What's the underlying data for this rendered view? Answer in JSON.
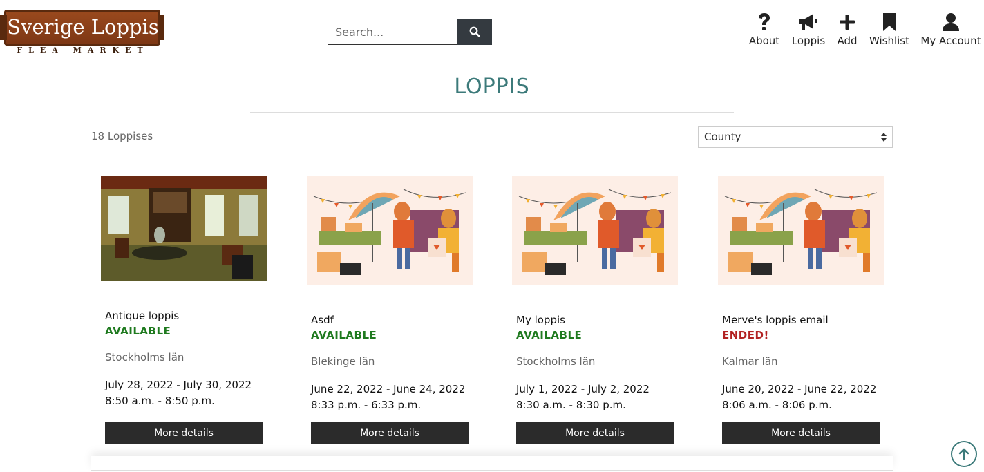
{
  "brand": {
    "title": "Sverige Loppis",
    "subtitle": "FLEA MARKET"
  },
  "search": {
    "placeholder": "Search..."
  },
  "nav": [
    {
      "label": "About",
      "icon": "question-icon"
    },
    {
      "label": "Loppis",
      "icon": "megaphone-icon"
    },
    {
      "label": "Add",
      "icon": "plus-icon"
    },
    {
      "label": "Wishlist",
      "icon": "bookmark-icon"
    },
    {
      "label": "My Account",
      "icon": "user-icon"
    }
  ],
  "page": {
    "title": "LOPPIS",
    "count": "18 Loppises"
  },
  "filter": {
    "selected": "County"
  },
  "cards": [
    {
      "name": "Antique loppis",
      "status": "AVAILABLE",
      "county": "Stockholms län",
      "dates": "July 28, 2022 - July 30, 2022",
      "times": "8:50 a.m. - 8:50 p.m.",
      "button": "More details"
    },
    {
      "name": "Asdf",
      "status": "AVAILABLE",
      "county": "Blekinge län",
      "dates": "June 22, 2022 - June 24, 2022",
      "times": "8:33 p.m. - 6:33 p.m.",
      "button": "More details"
    },
    {
      "name": "My loppis",
      "status": "AVAILABLE",
      "county": "Stockholms län",
      "dates": "July 1, 2022 - July 2, 2022",
      "times": "8:30 a.m. - 8:30 p.m.",
      "button": "More details"
    },
    {
      "name": "Merve's loppis email",
      "status": "ENDED!",
      "county": "Kalmar län",
      "dates": "June 20, 2022 - June 22, 2022",
      "times": "8:06 a.m. - 8:06 p.m.",
      "button": "More details"
    }
  ],
  "colors": {
    "accent": "#3c7a7a",
    "available": "#1f7a1f",
    "ended": "#b22222",
    "button": "#2b2b2b"
  }
}
